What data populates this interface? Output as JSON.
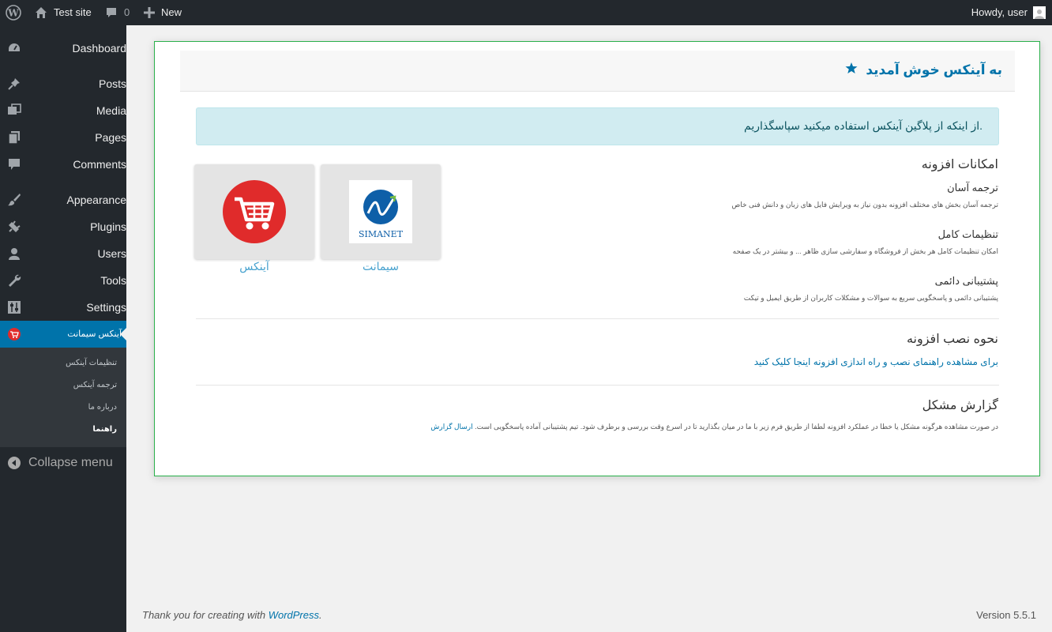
{
  "adminbar": {
    "site_name": "Test site",
    "comments_count": "0",
    "new_label": "New",
    "howdy": "Howdy, user"
  },
  "sidebar": {
    "items": [
      {
        "label": "Dashboard",
        "icon": "dashboard-icon"
      },
      {
        "label": "Posts",
        "icon": "pin-icon"
      },
      {
        "label": "Media",
        "icon": "media-icon"
      },
      {
        "label": "Pages",
        "icon": "pages-icon"
      },
      {
        "label": "Comments",
        "icon": "comment-icon"
      },
      {
        "label": "Appearance",
        "icon": "brush-icon"
      },
      {
        "label": "Plugins",
        "icon": "plugin-icon"
      },
      {
        "label": "Users",
        "icon": "user-icon"
      },
      {
        "label": "Tools",
        "icon": "wrench-icon"
      },
      {
        "label": "Settings",
        "icon": "sliders-icon"
      },
      {
        "label": "آینکس سیمانت",
        "icon": "cart-icon"
      }
    ],
    "submenu": [
      "تنظیمات آینکس",
      "ترجمه آینکس",
      "درباره ما",
      "راهنما"
    ],
    "collapse_label": "Collapse menu"
  },
  "main": {
    "title": "به آینکس خوش آمدید",
    "alert": ".از اینکه از پلاگین آینکس استفاده میکنید سپاسگذاریم",
    "tiles": [
      {
        "label": "سیمانت",
        "logo_text": "SIMANET"
      },
      {
        "label": "آینکس"
      }
    ],
    "features_title": "امکانات افزونه",
    "features": [
      {
        "title": "ترجمه آسان",
        "desc": "ترجمه آسان بخش های مختلف افزونه بدون نیاز به ویرایش فایل های زبان و دانش فنی خاص"
      },
      {
        "title": "تنظیمات کامل",
        "desc": "امکان تنظیمات کامل هر بخش از فروشگاه و سفارشی سازی ظاهر ... و بیشتر در یک صفحه"
      },
      {
        "title": "پشتیبانی دائمی",
        "desc": "پشتیبانی دائمی و پاسخگویی سریع به سوالات و مشکلات کاربران از طریق ایمیل و تیکت"
      }
    ],
    "install_title": "نحوه نصب افزونه",
    "install_link": "برای مشاهده راهنمای نصب و راه اندازی افزونه اینجا کلیک کنید",
    "report_title": "گزارش مشکل",
    "report_desc": "در صورت مشاهده هرگونه مشکل یا خطا در عملکرد افزونه لطفا از طریق فرم زیر با ما در میان بگذارید تا در اسرع وقت بررسی و برطرف شود. تیم پشتیبانی آماده پاسخگویی است.",
    "report_link": "ارسال گزارش"
  },
  "footer": {
    "thanks": "Thank you for creating with ",
    "wp": "WordPress",
    "period": ".",
    "version": "Version 5.5.1"
  },
  "colors": {
    "sidebar_bg": "#23282d",
    "accent": "#0073aa",
    "card_border": "#2ab04b",
    "alert_bg": "#d1ecf1"
  }
}
